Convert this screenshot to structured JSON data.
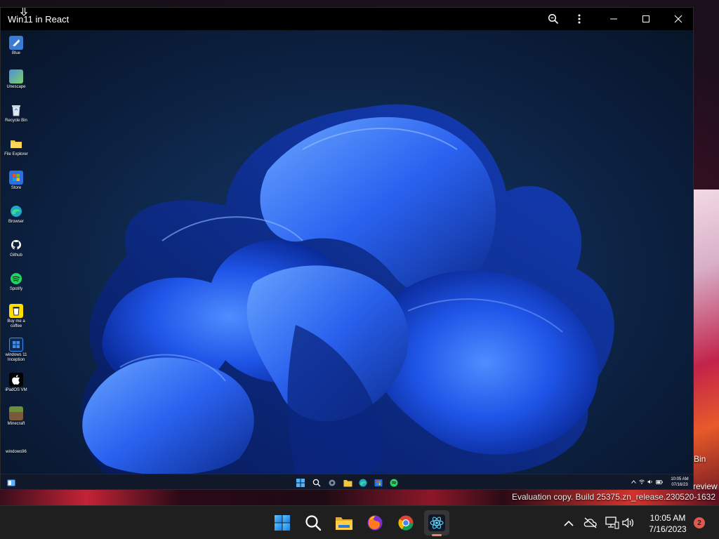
{
  "host": {
    "recycle_bin_label": "Bin",
    "preview_label": "review",
    "evaluation_text": "Evaluation copy. Build 25375.zn_release.230520-1632",
    "clock": {
      "time": "10:05 AM",
      "date": "7/16/2023"
    },
    "notification_count": "2",
    "taskbar": [
      {
        "name": "windows-start-icon"
      },
      {
        "name": "search-icon"
      },
      {
        "name": "file-explorer-icon"
      },
      {
        "name": "firefox-icon"
      },
      {
        "name": "chrome-icon"
      },
      {
        "name": "react-app-icon",
        "active": true
      }
    ],
    "tray": [
      "chevron-up-icon",
      "cloud-offline-icon",
      "network-icon",
      "volume-icon"
    ]
  },
  "window": {
    "title": "Win11 in React",
    "buttons": [
      "zoom-icon",
      "more-vertical-icon",
      "minimize-icon",
      "maximize-icon",
      "close-icon"
    ]
  },
  "guest": {
    "desktop_icons": [
      {
        "label": "Blue",
        "icon": "blue-icon",
        "color": "#3a7bd5"
      },
      {
        "label": "Unescape",
        "icon": "unescape-icon",
        "color": "#4a90d9"
      },
      {
        "label": "Recycle Bin",
        "icon": "recycle-bin-icon",
        "color": "#cfd8e3"
      },
      {
        "label": "File Explorer",
        "icon": "folder-icon",
        "color": "#f4c542"
      },
      {
        "label": "Store",
        "icon": "store-icon",
        "color": "#2f6fdd"
      },
      {
        "label": "Browser",
        "icon": "edge-icon",
        "color": "#1fa6c8"
      },
      {
        "label": "Github",
        "icon": "github-icon",
        "color": "#ffffff"
      },
      {
        "label": "Spotify",
        "icon": "spotify-icon",
        "color": "#1ed760"
      },
      {
        "label": "Buy me a coffee",
        "icon": "coffee-icon",
        "color": "#ffdd00"
      },
      {
        "label": "windows 11 Inception",
        "icon": "windows-icon",
        "color": "#3c8ee8"
      },
      {
        "label": "iPadOS VM",
        "icon": "apple-icon",
        "color": "#ffffff"
      },
      {
        "label": "Minecraft",
        "icon": "minecraft-icon",
        "color": "#6b8e3a"
      },
      {
        "label": "windows96",
        "icon": "",
        "color": ""
      }
    ],
    "taskbar": [
      "windows-start-icon",
      "search-icon",
      "settings-icon",
      "folder-icon",
      "edge-icon",
      "store-icon",
      "spotify-icon"
    ],
    "tray": [
      "chevron-up-icon",
      "wifi-icon",
      "volume-icon",
      "battery-icon"
    ],
    "clock": {
      "time": "10:05 AM",
      "date": "07/16/23"
    }
  }
}
